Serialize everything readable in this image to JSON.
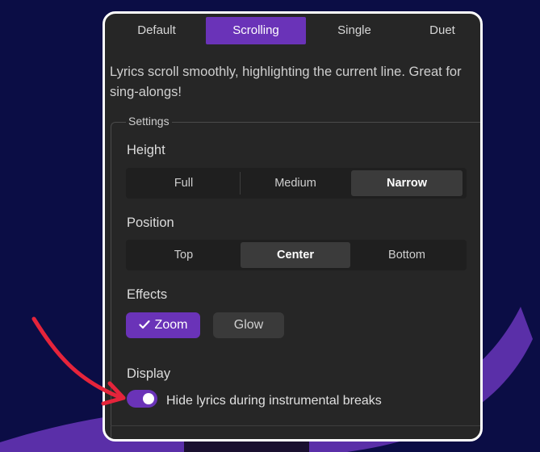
{
  "tabs": [
    {
      "label": "Default",
      "active": false
    },
    {
      "label": "Scrolling",
      "active": true
    },
    {
      "label": "Single",
      "active": false
    },
    {
      "label": "Duet",
      "active": false
    }
  ],
  "description": "Lyrics scroll smoothly, highlighting the current line. Great for sing-alongs!",
  "settings": {
    "legend": "Settings",
    "height": {
      "label": "Height",
      "options": [
        "Full",
        "Medium",
        "Narrow"
      ],
      "selected": "Narrow"
    },
    "position": {
      "label": "Position",
      "options": [
        "Top",
        "Center",
        "Bottom"
      ],
      "selected": "Center"
    },
    "effects": {
      "label": "Effects",
      "items": [
        {
          "label": "Zoom",
          "checked": true
        },
        {
          "label": "Glow",
          "checked": false
        }
      ]
    },
    "display": {
      "label": "Display",
      "toggle_label": "Hide lyrics during instrumental breaks",
      "toggle_on": true
    }
  },
  "colors": {
    "accent": "#6a33b8",
    "background": "#0b0d45",
    "panel": "#262626",
    "arrow": "#e5243b"
  },
  "icons": {
    "check": "check-icon",
    "annotation": "red-arrow-icon"
  }
}
